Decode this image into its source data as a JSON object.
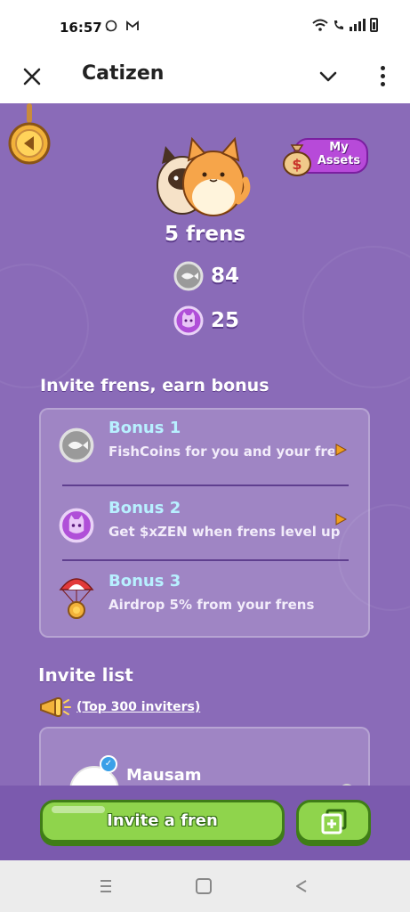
{
  "status_bar": {
    "time": "16:57",
    "left_icons": [
      "whatsapp-icon",
      "gmail-icon"
    ],
    "right_icons": [
      "wifi-icon",
      "wifi-call-icon",
      "signal-icon",
      "battery-icon"
    ]
  },
  "header": {
    "title": "Catizen"
  },
  "assets": {
    "label": "My Assets"
  },
  "stats": {
    "frens_count": "5 frens",
    "fishcoins": "84",
    "xzen": "25"
  },
  "invite_section": {
    "title": "Invite frens, earn bonus",
    "bonuses": [
      {
        "title": "Bonus 1",
        "desc": "FishCoins for you and your frens",
        "icon": "fishcoin-icon"
      },
      {
        "title": "Bonus 2",
        "desc": "Get $xZEN when frens level up",
        "icon": "xzen-cat-icon"
      },
      {
        "title": "Bonus 3",
        "desc": "Airdrop 5% from your frens",
        "icon": "parachute-coin-icon"
      }
    ]
  },
  "invite_list": {
    "title": "Invite list",
    "top_inviters": "(Top 300 inviters)",
    "invitees": [
      {
        "name": "Mausam"
      }
    ]
  },
  "actions": {
    "invite_label": "Invite a fren"
  },
  "colors": {
    "game_bg": "#8a6bb8",
    "bonus_title": "#b8f0ff",
    "button_green": "#8fd44c",
    "button_border": "#3f7d17",
    "assets_purple": "#b74ad9"
  }
}
